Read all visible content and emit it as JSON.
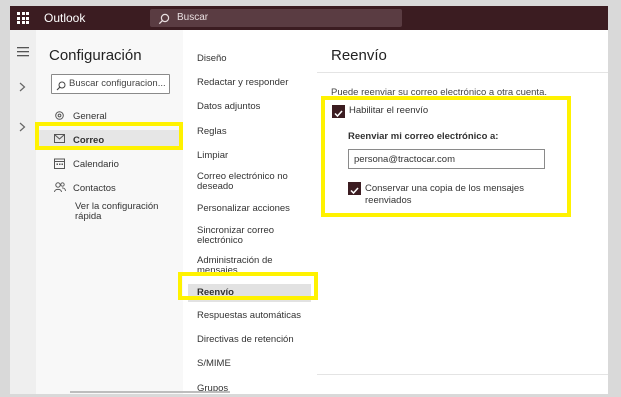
{
  "app": {
    "title": "Outlook"
  },
  "search": {
    "placeholder": "Buscar"
  },
  "settings": {
    "title": "Configuración",
    "search_placeholder": "Buscar configuracion...",
    "categories": [
      {
        "label": "General",
        "icon": "gear-icon"
      },
      {
        "label": "Correo",
        "icon": "mail-icon",
        "selected": true
      },
      {
        "label": "Calendario",
        "icon": "calendar-icon"
      },
      {
        "label": "Contactos",
        "icon": "people-icon"
      },
      {
        "label": "Ver la configuración rápida"
      }
    ]
  },
  "mail_settings": {
    "items": [
      "Diseño",
      "Redactar y responder",
      "Datos adjuntos",
      "Reglas",
      "Limpiar",
      "Correo electrónico no deseado",
      "Personalizar acciones",
      "Sincronizar correo electrónico",
      "Administración de mensajes",
      "Reenvío",
      "Respuestas automáticas",
      "Directivas de retención",
      "S/MIME",
      "Grupos"
    ],
    "selected": "Reenvío"
  },
  "forwarding": {
    "title": "Reenvío",
    "info": "Puede reenviar su correo electrónico a otra cuenta.",
    "enable_label": "Habilitar el reenvío",
    "enabled": true,
    "forward_to_label": "Reenviar mi correo electrónico a:",
    "forward_to_value": "persona@tractocar.com",
    "keep_copy_label": "Conservar una copia de los mensajes reenviados",
    "keep_copy": true
  },
  "colors": {
    "brand": "#3b1c21",
    "highlight": "#fff200",
    "checkbox": "#3b1c21"
  }
}
